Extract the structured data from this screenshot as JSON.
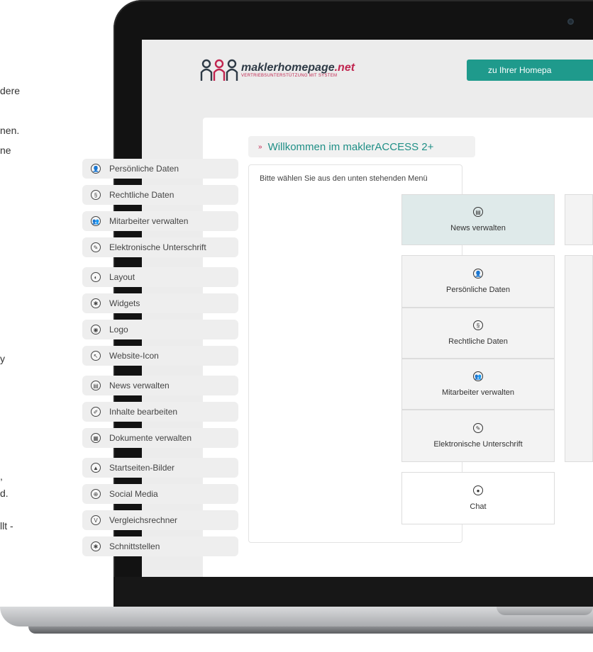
{
  "background_fragments": [
    "dere",
    "nen.",
    "ne",
    "y",
    ",",
    "d.",
    "llt -"
  ],
  "header": {
    "logo_name": "maklerhomepage",
    "logo_tld": ".net",
    "logo_tagline": "VERTRIEBSUNTERSTÜTZUNG MIT SYSTEM",
    "homepage_button": "zu Ihrer Homepa"
  },
  "sidebar": {
    "items": [
      {
        "label": "Persönliche Daten",
        "icon": "person-icon",
        "glyph": "👤"
      },
      {
        "label": "Rechtliche Daten",
        "icon": "paragraph-icon",
        "glyph": "§"
      },
      {
        "label": "Mitarbeiter verwalten",
        "icon": "team-icon",
        "glyph": "👥"
      },
      {
        "label": "Elektronische Unterschrift",
        "icon": "pen-icon",
        "glyph": "✎"
      },
      {
        "label": "Layout",
        "icon": "contrast-icon",
        "glyph": "◐"
      },
      {
        "label": "Widgets",
        "icon": "puzzle-icon",
        "glyph": "✱"
      },
      {
        "label": "Logo",
        "icon": "eye-icon",
        "glyph": "◉"
      },
      {
        "label": "Website-Icon",
        "icon": "cursor-icon",
        "glyph": "↖"
      },
      {
        "label": "News verwalten",
        "icon": "newspaper-icon",
        "glyph": "▤"
      },
      {
        "label": "Inhalte bearbeiten",
        "icon": "edit-icon",
        "glyph": "✐"
      },
      {
        "label": "Dokumente verwalten",
        "icon": "document-icon",
        "glyph": "▦"
      },
      {
        "label": "Startseiten-Bilder",
        "icon": "image-icon",
        "glyph": "▲"
      },
      {
        "label": "Social Media",
        "icon": "globe-icon",
        "glyph": "⊕"
      },
      {
        "label": "Vergleichsrechner",
        "icon": "versus-icon",
        "glyph": "V"
      },
      {
        "label": "Schnittstellen",
        "icon": "plug-icon",
        "glyph": "✱"
      },
      {
        "label": "Chat",
        "icon": "chat-icon",
        "glyph": "●"
      }
    ]
  },
  "main": {
    "welcome_arrow": "»",
    "welcome_title": "Willkommen im maklerACCESS 2+",
    "intro_text": "Bitte wählen Sie aus den unten stehenden Menü",
    "tiles": [
      {
        "label": "News verwalten",
        "icon": "newspaper-icon",
        "glyph": "▤"
      },
      {
        "label": "Persönliche Daten",
        "icon": "person-icon",
        "glyph": "👤"
      },
      {
        "label": "Rechtliche Daten",
        "icon": "paragraph-icon",
        "glyph": "§"
      },
      {
        "label": "Mitarbeiter verwalten",
        "icon": "team-icon",
        "glyph": "👥"
      },
      {
        "label": "Elektronische Unterschrift",
        "icon": "pen-icon",
        "glyph": "✎"
      },
      {
        "label": "Chat",
        "icon": "chat-icon",
        "glyph": "●"
      }
    ]
  },
  "colors": {
    "accent": "#1f9a8c",
    "brand_red": "#c0254f",
    "tile_teal": "#dfeaea"
  }
}
